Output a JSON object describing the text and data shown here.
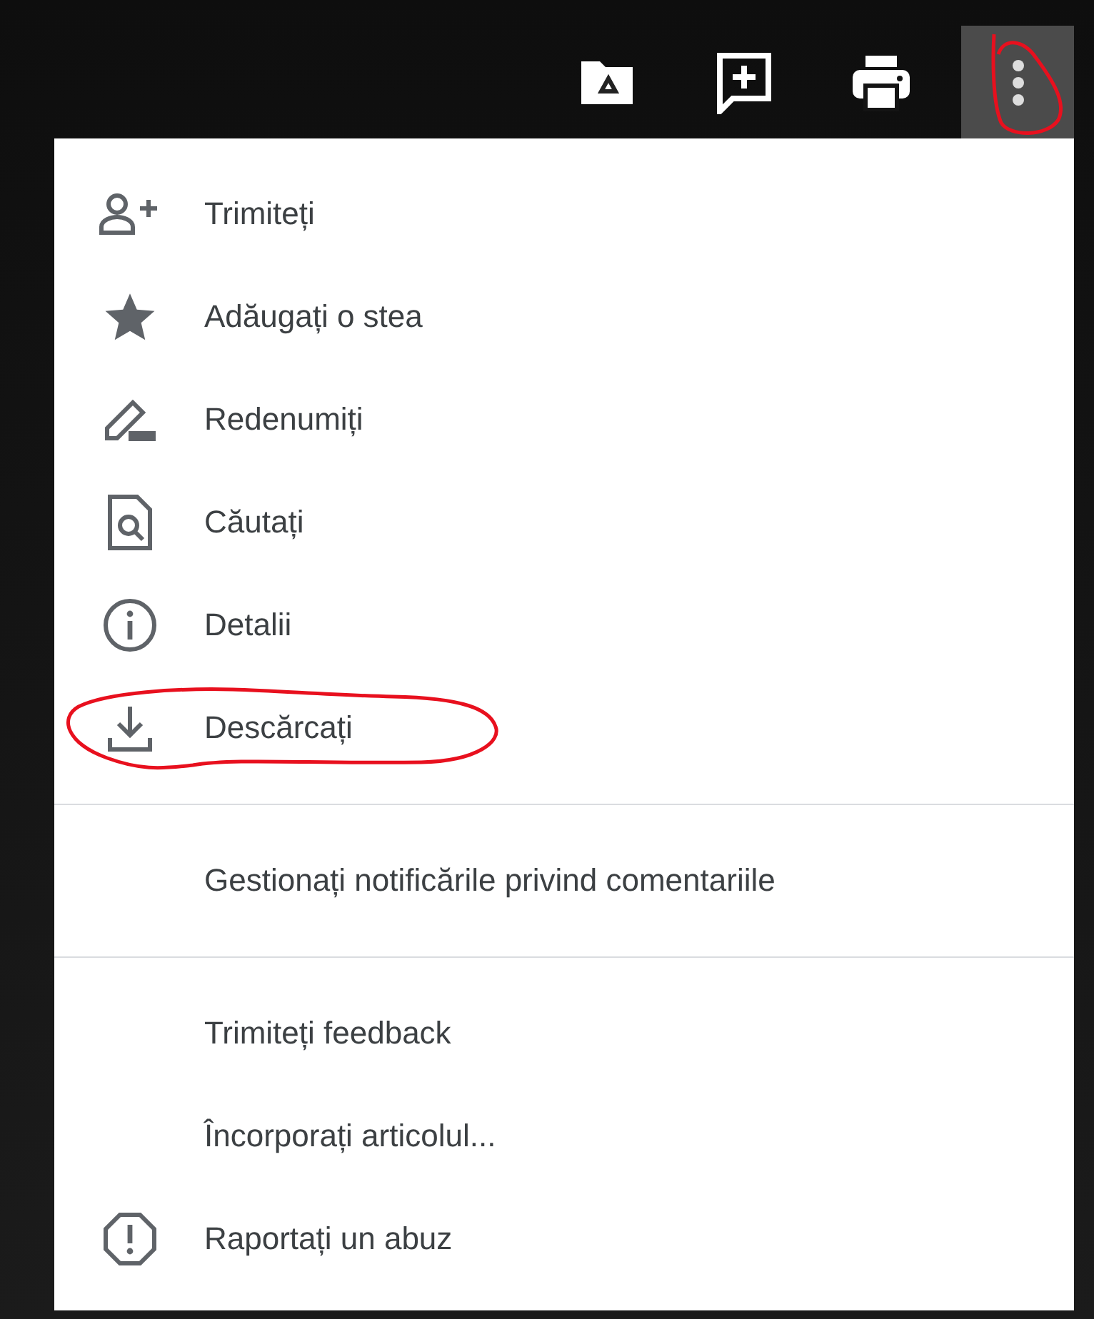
{
  "toolbar": [
    {
      "kind": "drive-folder",
      "active": false,
      "circled": false
    },
    {
      "kind": "add-comment",
      "active": false,
      "circled": false
    },
    {
      "kind": "print",
      "active": false,
      "circled": false
    },
    {
      "kind": "more",
      "active": true,
      "circled": true
    }
  ],
  "menu": {
    "groups": [
      {
        "items": [
          {
            "kind": "share",
            "label": "Trimiteți",
            "circled": false
          },
          {
            "kind": "star",
            "label": "Adăugați o stea",
            "circled": false
          },
          {
            "kind": "rename",
            "label": "Redenumiți",
            "circled": false
          },
          {
            "kind": "find",
            "label": "Căutați",
            "circled": false
          },
          {
            "kind": "info",
            "label": "Detalii",
            "circled": false
          },
          {
            "kind": "download",
            "label": "Descărcați",
            "circled": true
          }
        ]
      },
      {
        "items": [
          {
            "kind": "plain",
            "label": "Gestionați notificările privind comentariile",
            "circled": false
          }
        ]
      },
      {
        "items": [
          {
            "kind": "plain",
            "label": "Trimiteți feedback",
            "circled": false
          },
          {
            "kind": "plain",
            "label": "Încorporați articolul...",
            "circled": false
          },
          {
            "kind": "report",
            "label": "Raportați un abuz",
            "circled": false
          }
        ]
      }
    ]
  }
}
